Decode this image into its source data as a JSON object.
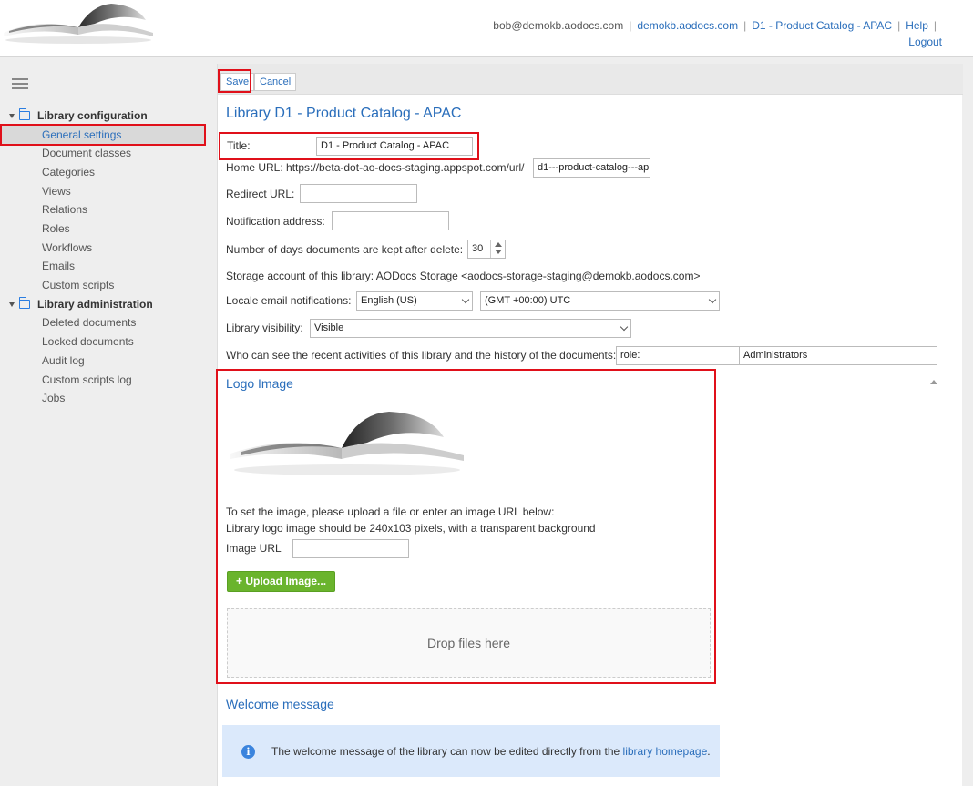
{
  "header": {
    "user_email": "bob@demokb.aodocs.com",
    "links": [
      "demokb.aodocs.com",
      "D1 - Product Catalog - APAC",
      "Help",
      "Logout"
    ]
  },
  "sidebar": {
    "groups": [
      {
        "label": "Library configuration",
        "items": [
          "General settings",
          "Document classes",
          "Categories",
          "Views",
          "Relations",
          "Roles",
          "Workflows",
          "Emails",
          "Custom scripts"
        ]
      },
      {
        "label": "Library administration",
        "items": [
          "Deleted documents",
          "Locked documents",
          "Audit log",
          "Custom scripts log",
          "Jobs"
        ]
      }
    ],
    "active_item": "General settings"
  },
  "toolbar": {
    "save_label": "Save",
    "cancel_label": "Cancel"
  },
  "form": {
    "heading": "Library D1 - Product Catalog - APAC",
    "title_label": "Title:",
    "title_value": "D1 - Product Catalog - APAC",
    "home_url_label": "Home URL: https://beta-dot-ao-docs-staging.appspot.com/url/",
    "home_url_value": "d1---product-catalog---ap",
    "redirect_label": "Redirect URL:",
    "redirect_value": "",
    "notification_label": "Notification address:",
    "notification_value": "",
    "days_label": "Number of days documents are kept after delete:",
    "days_value": "30",
    "storage_text": "Storage account of this library: AODocs Storage <aodocs-storage-staging@demokb.aodocs.com>",
    "locale_label": "Locale email notifications:",
    "locale_value": "English (US)",
    "timezone_value": "(GMT +00:00) UTC",
    "visibility_label": "Library visibility:",
    "visibility_value": "Visible",
    "activity_label": "Who can see the recent activities of this library and the history of the documents:",
    "activity_role_value": "role:",
    "activity_group_value": "Administrators"
  },
  "logo_section": {
    "title": "Logo Image",
    "instructions_1": "To set the image, please upload a file or enter an image URL below:",
    "instructions_2": "Library logo image should be 240x103 pixels, with a transparent background",
    "image_url_label": "Image URL",
    "image_url_value": "",
    "upload_label": "Upload Image...",
    "drop_label": "Drop files here"
  },
  "welcome_section": {
    "title": "Welcome message",
    "info_text": "The welcome message of the library can now be edited directly from the",
    "info_link": "library homepage",
    "info_end": "."
  },
  "icons": {
    "logo": "open-book-logo",
    "menu": "hamburger-icon",
    "folder": "folder-icon",
    "info": "info-icon",
    "plus": "plus-icon"
  },
  "colors": {
    "accent": "#2a6ebb",
    "highlight": "#e0101a",
    "upload": "#6ab42d",
    "info_bg": "#dbe9fb"
  }
}
